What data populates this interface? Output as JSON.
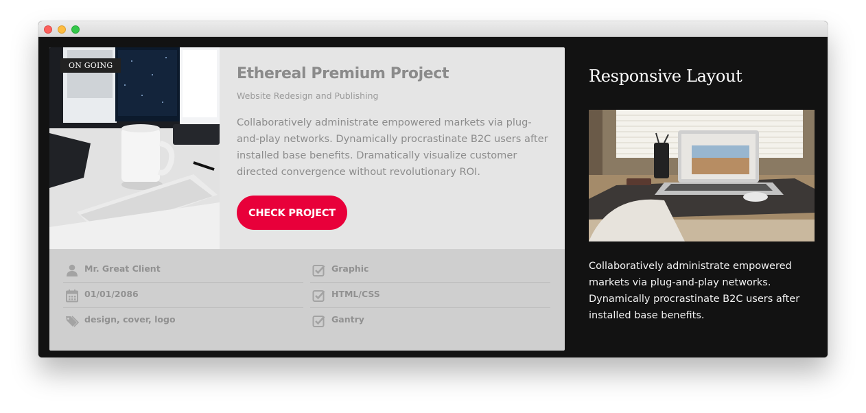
{
  "window": {
    "buttons": [
      "close",
      "minimize",
      "zoom"
    ]
  },
  "card": {
    "badge": "ON GOING",
    "title": "Ethereal Premium Project",
    "subtitle": "Website Redesign and Publishing",
    "description": "Collaboratively administrate empowered markets via plug-and-play networks. Dynamically procrastinate B2C users after installed base benefits. Dramatically visualize customer directed convergence without revolutionary ROI.",
    "cta_label": "CHECK PROJECT",
    "photo_alt": "Desk with mug, keyboard and monitors",
    "meta_left": [
      {
        "icon": "user-icon",
        "text": "Mr. Great Client"
      },
      {
        "icon": "calendar-icon",
        "text": "01/01/2086"
      },
      {
        "icon": "tags-icon",
        "text": "design, cover, logo"
      }
    ],
    "meta_right": [
      {
        "icon": "check-square-icon",
        "text": "Graphic"
      },
      {
        "icon": "check-square-icon",
        "text": "HTML/CSS"
      },
      {
        "icon": "check-square-icon",
        "text": "Gantry"
      }
    ]
  },
  "side": {
    "title": "Responsive Layout",
    "photo_alt": "Laptop on a desk by a window",
    "text": "Collaboratively administrate empowered markets via plug-and-play networks. Dynamically procrastinate B2C users after installed base benefits."
  },
  "colors": {
    "accent": "#e8003a",
    "background": "#121212",
    "card_top": "#e5e5e5",
    "card_bottom": "#cfcfcf"
  }
}
